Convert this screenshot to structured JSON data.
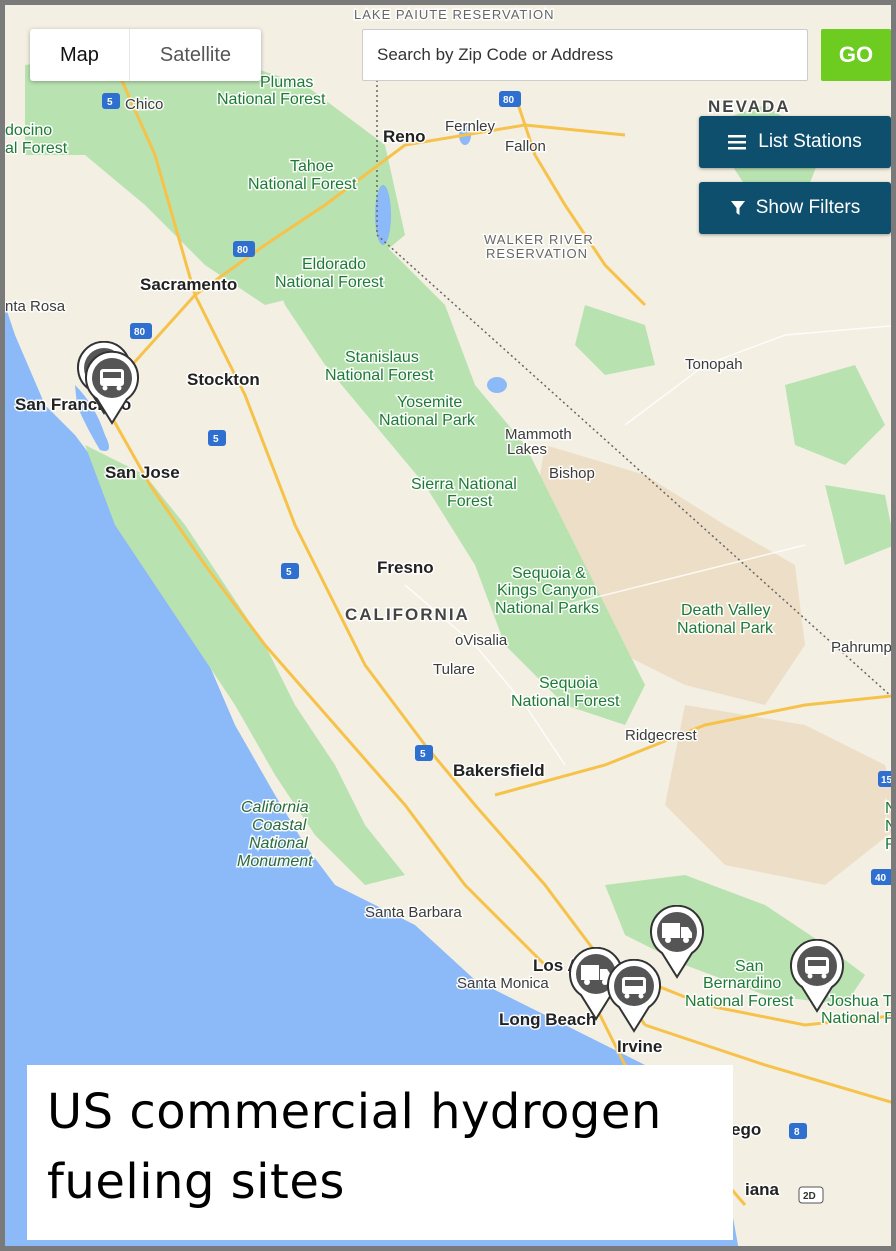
{
  "map_controls": {
    "map_label": "Map",
    "satellite_label": "Satellite",
    "active": "Map"
  },
  "search": {
    "placeholder": "Search by Zip Code or Address",
    "go_label": "GO"
  },
  "buttons": {
    "list_stations": "List Stations",
    "list_icon": "hamburger-menu-icon",
    "show_filters": "Show Filters",
    "filter_icon": "funnel-icon",
    "accent_color": "#0f4f6e",
    "go_color": "#6dcc1f"
  },
  "map": {
    "colors": {
      "land": "#f3efe3",
      "forest": "#b9e2b1",
      "water": "#8cb9f7",
      "desert": "#eddfc7",
      "road": "#f6c24a"
    },
    "states": [
      "NEVADA",
      "CALIFORNIA"
    ],
    "reservation": {
      "line1": "WALKER RIVER",
      "line2": "RESERVATION"
    },
    "reservation_top": "LAKE PAIUTE RESERVATION",
    "cities": [
      "Chico",
      "Reno",
      "Fernley",
      "Fallon",
      "Sacramento",
      "Stockton",
      "San Francisco",
      "San Jose",
      "Fresno",
      "oVisalia",
      "Tulare",
      "Bakersfield",
      "Tonopah",
      "Bishop",
      "Mammoth",
      "Lakes",
      "Ridgecrest",
      "Pahrump",
      "Santa Barbara",
      "Santa Monica",
      "Long Beach",
      "Irvine",
      "Los Angeles",
      "ego",
      "iana",
      "nta Rosa"
    ],
    "parks": [
      "Plumas",
      "National Forest",
      "docino",
      "al Forest",
      "Tahoe",
      "National Forest",
      "Eldorado",
      "National Forest",
      "Stanislaus",
      "National Forest",
      "Yosemite",
      "National Park",
      "Sierra National",
      "Forest",
      "Sequoia &",
      "Kings Canyon",
      "National Parks",
      "Death Valley",
      "National Park",
      "Sequoia",
      "National Forest",
      "California",
      "Coastal",
      "National",
      "Monument",
      "San",
      "Bernardino",
      "National Forest",
      "Joshua T",
      "National P",
      "N",
      "N",
      "P"
    ],
    "highways": [
      "5",
      "80",
      "80",
      "80",
      "5",
      "5",
      "5",
      "15",
      "40",
      "8",
      "2D"
    ]
  },
  "markers": [
    {
      "name": "bus-station-marker",
      "icon": "bus-icon"
    },
    {
      "name": "bus-station-marker",
      "icon": "bus-icon"
    },
    {
      "name": "truck-station-marker",
      "icon": "truck-icon"
    },
    {
      "name": "truck-station-marker",
      "icon": "truck-icon"
    },
    {
      "name": "bus-station-marker",
      "icon": "bus-icon"
    },
    {
      "name": "bus-station-marker",
      "icon": "bus-icon"
    }
  ],
  "caption": {
    "line1": "US commercial hydrogen",
    "line2": "fueling sites"
  }
}
